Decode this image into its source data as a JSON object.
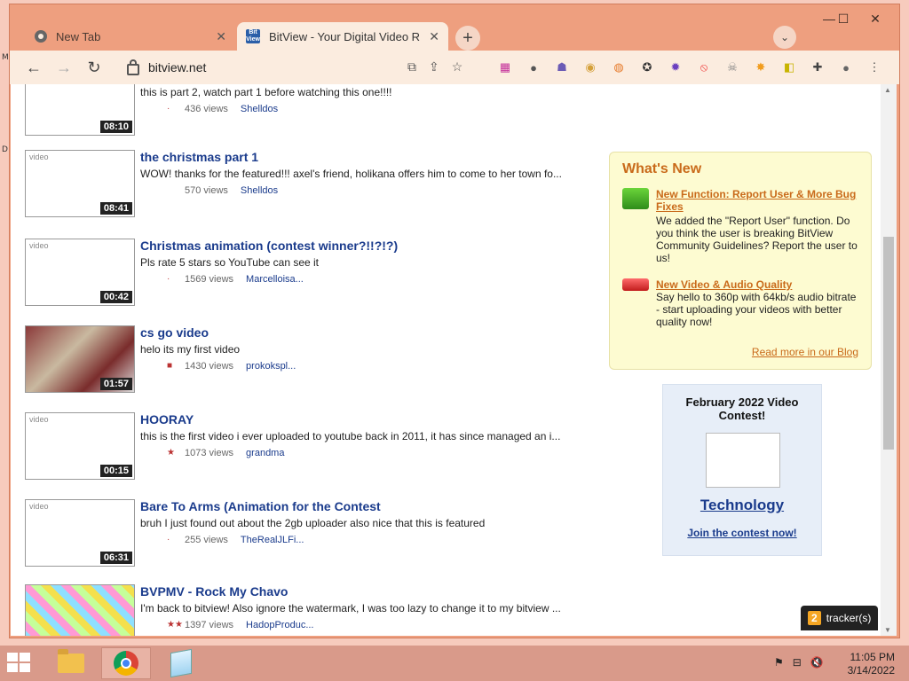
{
  "desktop": {
    "frag1": "M",
    "frag2": "D"
  },
  "browser": {
    "tabs": [
      {
        "label": "New Tab",
        "icon": "chrome-icon"
      },
      {
        "label": "BitView - Your Digital Video Repo",
        "icon": "bitview-icon",
        "favicon_text": "Bit View"
      }
    ],
    "new_tab_symbol": "+",
    "tab_search_symbol": "⌄",
    "window_controls": {
      "minimize": "—",
      "maximize": "☐",
      "close": "✕"
    },
    "address": "bitview.net",
    "nav": {
      "back": "←",
      "forward": "→",
      "reload": "↻"
    },
    "extensions": [
      "colors-ext-icon",
      "hat-ext-icon",
      "invader-ext-icon",
      "doge-ext-icon",
      "ball-ext-icon",
      "globe-ext-icon",
      "star-ext-icon",
      "block-ext-icon",
      "skull-ext-icon",
      "sun-ext-icon",
      "bee-ext-icon",
      "puzzle-ext-icon",
      "profile-icon",
      "menu-icon"
    ],
    "extension_glyphs": [
      "▦",
      "●",
      "☗",
      "◉",
      "◍",
      "✪",
      "✹",
      "⦸",
      "☠",
      "✸",
      "◧",
      "✚",
      "●",
      "⋮"
    ],
    "extension_colors": [
      "#c42f9a",
      "#555",
      "#6b5bb5",
      "#d4a03a",
      "#e67a2a",
      "#333",
      "#6b3fbf",
      "#e33",
      "#888",
      "#f19c1d",
      "#c8b400",
      "#444",
      "#666",
      "#444"
    ]
  },
  "videos": [
    {
      "title": "",
      "description": "this is part 2, watch part 1 before watching this one!!!!",
      "views": "436 views",
      "uploader": "Shelldos",
      "duration": "08:10",
      "thumb": "broken",
      "rating": "·"
    },
    {
      "title": "the christmas part 1",
      "description": "WOW! thanks for the featured!!! axel's friend, holikana offers him to come to her town fo...",
      "views": "570 views",
      "uploader": "Shelldos",
      "duration": "08:41",
      "thumb": "broken",
      "rating": ""
    },
    {
      "title": "Christmas animation (contest winner?!!?!?)",
      "description": "Pls rate 5 stars so YouTube can see it",
      "views": "1569 views",
      "uploader": "Marcelloisa...",
      "duration": "00:42",
      "thumb": "broken",
      "rating": "·"
    },
    {
      "title": "cs go video",
      "description": "helo its my first video",
      "views": "1430 views",
      "uploader": "prokokspl...",
      "duration": "01:57",
      "thumb": "cs",
      "rating": "■"
    },
    {
      "title": "HOORAY",
      "description": "this is the first video i ever uploaded to youtube back in 2011, it has since managed an i...",
      "views": "1073 views",
      "uploader": "grandma",
      "duration": "00:15",
      "thumb": "broken",
      "rating": "★"
    },
    {
      "title": "Bare To Arms (Animation for the Contest",
      "description": "bruh I just found out about the 2gb uploader also nice that this is featured",
      "views": "255 views",
      "uploader": "TheRealJLFi...",
      "duration": "06:31",
      "thumb": "broken",
      "rating": "·"
    },
    {
      "title": "BVPMV - Rock My Chavo",
      "description": "I'm back to bitview! Also ignore the watermark, I was too lazy to change it to my bitview ...",
      "views": "1397 views",
      "uploader": "HadopProduc...",
      "duration": "",
      "thumb": "bvp",
      "rating": "★★"
    }
  ],
  "broken_img_alt": "video",
  "whats_new": {
    "heading": "What's New",
    "items": [
      {
        "link": "New Function: Report User & More Bug Fixes",
        "text": "We added the \"Report User\" function. Do you think the user is breaking BitView Community Guidelines? Report the user to us!"
      },
      {
        "link": "New Video & Audio Quality",
        "text": "Say hello to 360p with 64kb/s audio bitrate - start uploading your videos with better quality now!"
      }
    ],
    "read_more": "Read more in our Blog"
  },
  "contest": {
    "title": "February 2022 Video Contest!",
    "theme": "Technology",
    "join": "Join the contest now!"
  },
  "tracker": {
    "count": "2",
    "label": "tracker(s)"
  },
  "taskbar": {
    "apps": [
      "file-explorer-icon",
      "chrome-icon",
      "notepad-icon"
    ],
    "tray_icons": [
      "⚑",
      "⊟",
      "🔇"
    ],
    "time": "11:05 PM",
    "date": "3/14/2022"
  }
}
